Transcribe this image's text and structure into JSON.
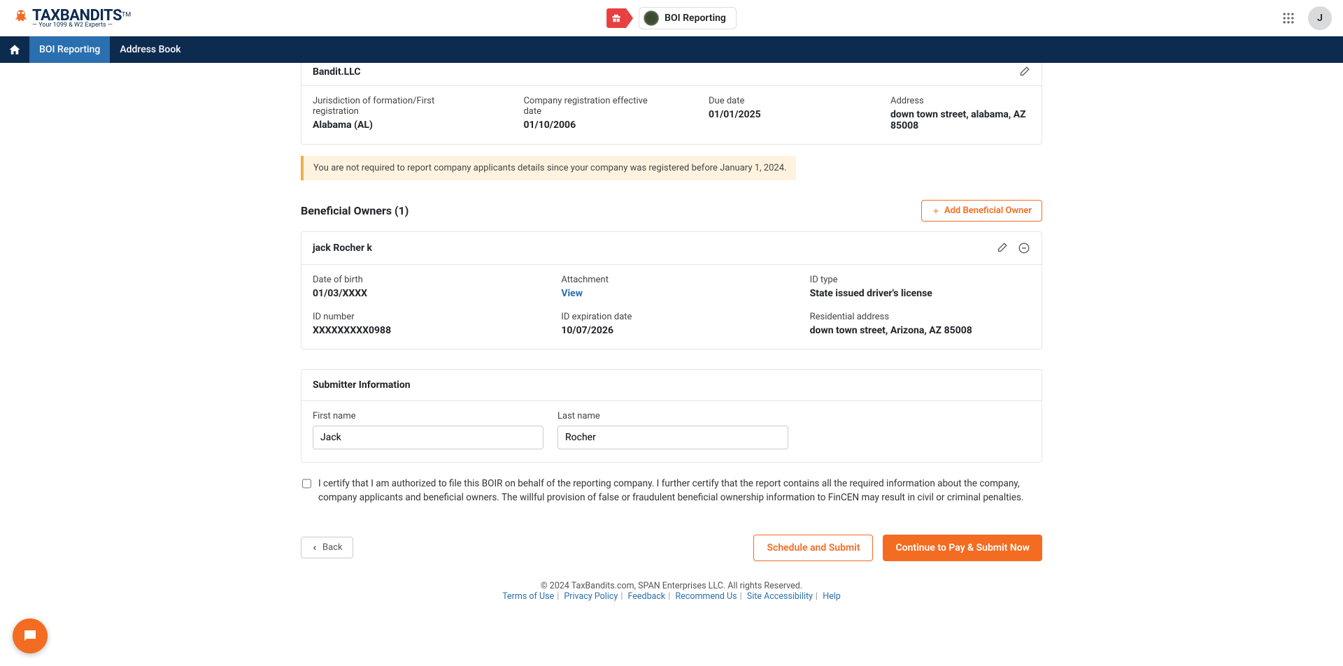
{
  "brand": {
    "name": "TAXBANDITS",
    "tagline": "— Your 1099 & W2 Experts —",
    "trademark": "TM"
  },
  "topbar": {
    "boi_pill": "BOI Reporting",
    "avatar_initial": "J"
  },
  "nav": {
    "items": [
      "BOI Reporting",
      "Address Book"
    ],
    "active_index": 0
  },
  "company": {
    "name": "Bandit.LLC",
    "jurisdiction_label": "Jurisdiction of formation/First registration",
    "jurisdiction_value": "Alabama (AL)",
    "eff_date_label": "Company registration effective date",
    "eff_date_value": "01/10/2006",
    "due_date_label": "Due date",
    "due_date_value": "01/01/2025",
    "address_label": "Address",
    "address_value": "down town street, alabama, AZ 85008"
  },
  "notice": "You are not required to report company applicants details since your company was registered before January 1, 2024.",
  "owners_section": {
    "title": "Beneficial Owners (1)",
    "add_label": "Add Beneficial Owner"
  },
  "owner": {
    "name": "jack Rocher k",
    "dob_label": "Date of birth",
    "dob_value": "01/03/XXXX",
    "attach_label": "Attachment",
    "attach_link": "View",
    "idtype_label": "ID type",
    "idtype_value": "State issued driver's license",
    "idnum_label": "ID number",
    "idnum_value": "XXXXXXXXX0988",
    "idexp_label": "ID expiration date",
    "idexp_value": "10/07/2026",
    "res_label": "Residential address",
    "res_value": "down town street, Arizona, AZ 85008"
  },
  "submitter": {
    "title": "Submitter Information",
    "first_label": "First name",
    "first_value": "Jack",
    "last_label": "Last name",
    "last_value": "Rocher"
  },
  "cert_text": "I certify that I am authorized to file this BOIR on behalf of the reporting company. I further certify that the report contains all the required information about the company, company applicants and beneficial owners. The willful provision of false or fraudulent beneficial ownership information to FinCEN may result in civil or criminal penalties.",
  "actions": {
    "back": "Back",
    "schedule": "Schedule and Submit",
    "continue": "Continue to Pay & Submit Now"
  },
  "footer": {
    "copyright": "© 2024 TaxBandits.com, SPAN Enterprises LLC. All rights Reserved.",
    "links": [
      "Terms of Use",
      "Privacy Policy",
      "Feedback",
      "Recommend Us",
      "Site Accessibility",
      "Help"
    ]
  }
}
